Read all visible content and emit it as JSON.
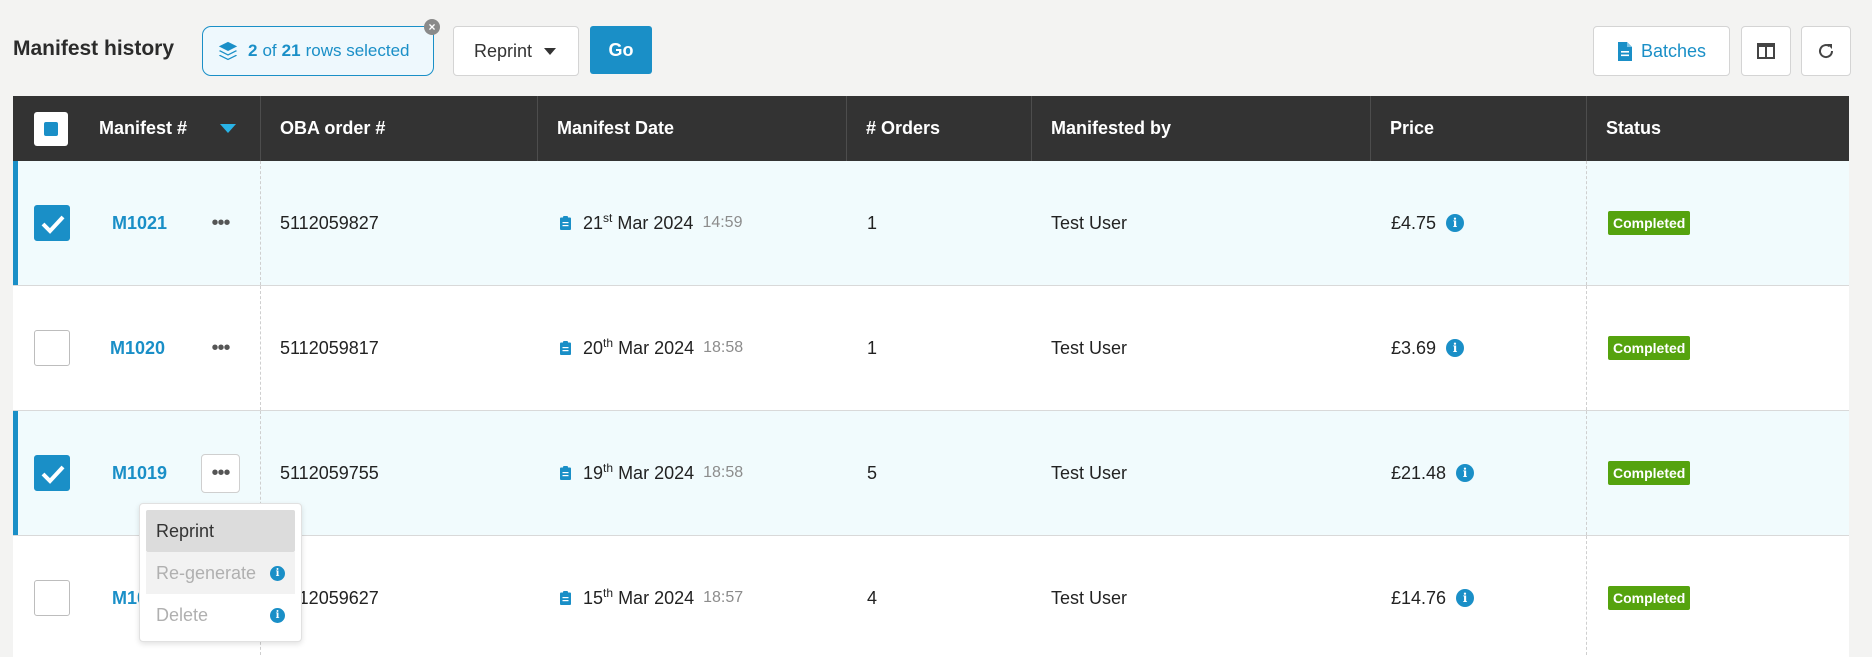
{
  "toolbar": {
    "title": "Manifest history",
    "selection": {
      "selected": "2",
      "of_text": "of",
      "total": "21",
      "suffix": "rows selected"
    },
    "action_select": {
      "value": "Reprint"
    },
    "go_label": "Go",
    "batches_label": "Batches"
  },
  "columns": {
    "manifest": "Manifest #",
    "oba_order": "OBA order #",
    "manifest_date": "Manifest Date",
    "orders": "# Orders",
    "manifested_by": "Manifested by",
    "price": "Price",
    "status": "Status"
  },
  "rows": [
    {
      "manifest": "M1021",
      "oba": "5112059827",
      "day": "21",
      "suffix": "st",
      "month_year": "Mar 2024",
      "time": "14:59",
      "orders": "1",
      "by": "Test User",
      "price": "£4.75",
      "status": "Completed",
      "checked": true
    },
    {
      "manifest": "M1020",
      "oba": "5112059817",
      "day": "20",
      "suffix": "th",
      "month_year": "Mar 2024",
      "time": "18:58",
      "orders": "1",
      "by": "Test User",
      "price": "£3.69",
      "status": "Completed",
      "checked": false
    },
    {
      "manifest": "M1019",
      "oba": "5112059755",
      "day": "19",
      "suffix": "th",
      "month_year": "Mar 2024",
      "time": "18:58",
      "orders": "5",
      "by": "Test User",
      "price": "£21.48",
      "status": "Completed",
      "checked": true
    },
    {
      "manifest": "M10",
      "oba": "112059627",
      "day": "15",
      "suffix": "th",
      "month_year": "Mar 2024",
      "time": "18:57",
      "orders": "4",
      "by": "Test User",
      "price": "£14.76",
      "status": "Completed",
      "checked": false
    }
  ],
  "row_menu": {
    "items": [
      {
        "label": "Reprint"
      },
      {
        "label": "Re-generate"
      },
      {
        "label": "Delete"
      }
    ]
  },
  "colors": {
    "accent": "#1a8fc7",
    "header_bg": "#333333",
    "status_completed": "#55a30e",
    "selected_row_bg": "#f1fbfd"
  },
  "icons": {
    "selection": "layers-icon",
    "clear_selection": "close-icon",
    "batches": "document-icon",
    "columns": "columns-icon",
    "refresh": "refresh-icon",
    "date": "clipboard-icon",
    "price_info": "info-icon"
  }
}
